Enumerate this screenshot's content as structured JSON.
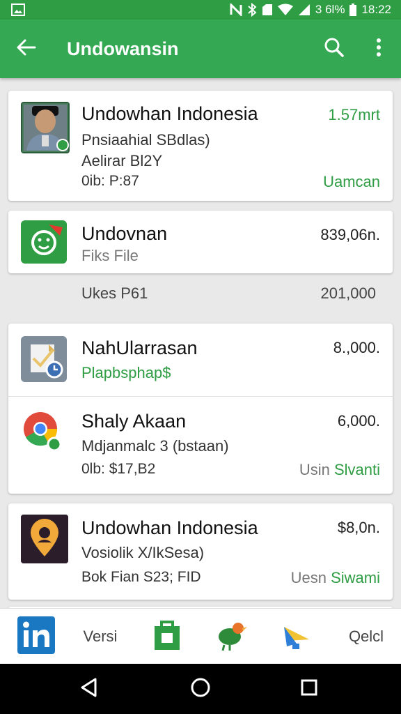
{
  "status_bar": {
    "battery_text": "3 6l%",
    "time": "18:22"
  },
  "app_bar": {
    "title": "Undowansin",
    "icons": [
      "back-arrow-icon",
      "search-icon",
      "more-vert-icon"
    ]
  },
  "items": [
    {
      "title": "Undowhan Indonesia",
      "line2": "Pnsiaahial SBdlas)",
      "line3": "Aelirar Bl2Y",
      "line4": "0ib: P:87",
      "right_top": "1.57mrt",
      "right_bottom": "Uamcan",
      "icon": "person-photo-icon"
    },
    {
      "title": "Undovnan",
      "line2": "Fiks File",
      "right_top": "839,06n.",
      "icon": "green-smile-app-icon"
    },
    {
      "left": "Ukes P61",
      "right": "201,000"
    },
    {
      "title": "NahUlarrasan",
      "line2": "Plapbsphap$",
      "right_top": "8.,000.",
      "icon": "document-clock-icon"
    },
    {
      "title": "Shaly Akaan",
      "line2": "Mdjanmalc 3 (bstaan)",
      "line3": "0lb: $17,B2",
      "right_top": "6,000.",
      "right_prefix": "Usin",
      "right_bottom": "Slvanti",
      "icon": "chrome-icon"
    },
    {
      "title": "Undowhan Indonesia",
      "line2": "Vosiolik X/IkSesa)",
      "line3": "Bok Fian S23; FID",
      "right_top": "$8,0n.",
      "right_prefix": "Uesn",
      "right_bottom": "Siwami",
      "icon": "location-pin-icon"
    }
  ],
  "bottom_bar": {
    "items": [
      {
        "icon": "linkedin-icon"
      },
      {
        "label": "Versi"
      },
      {
        "icon": "green-bag-icon"
      },
      {
        "icon": "bird-icon"
      },
      {
        "icon": "blue-fan-icon"
      },
      {
        "label": "Qelcl"
      }
    ]
  },
  "nav_bar": {
    "icons": [
      "back-triangle-icon",
      "home-circle-icon",
      "recents-square-icon"
    ]
  },
  "colors": {
    "app_bar": "#34a853",
    "status_bar": "#2e9d43",
    "accent_green": "#2e9d43"
  }
}
